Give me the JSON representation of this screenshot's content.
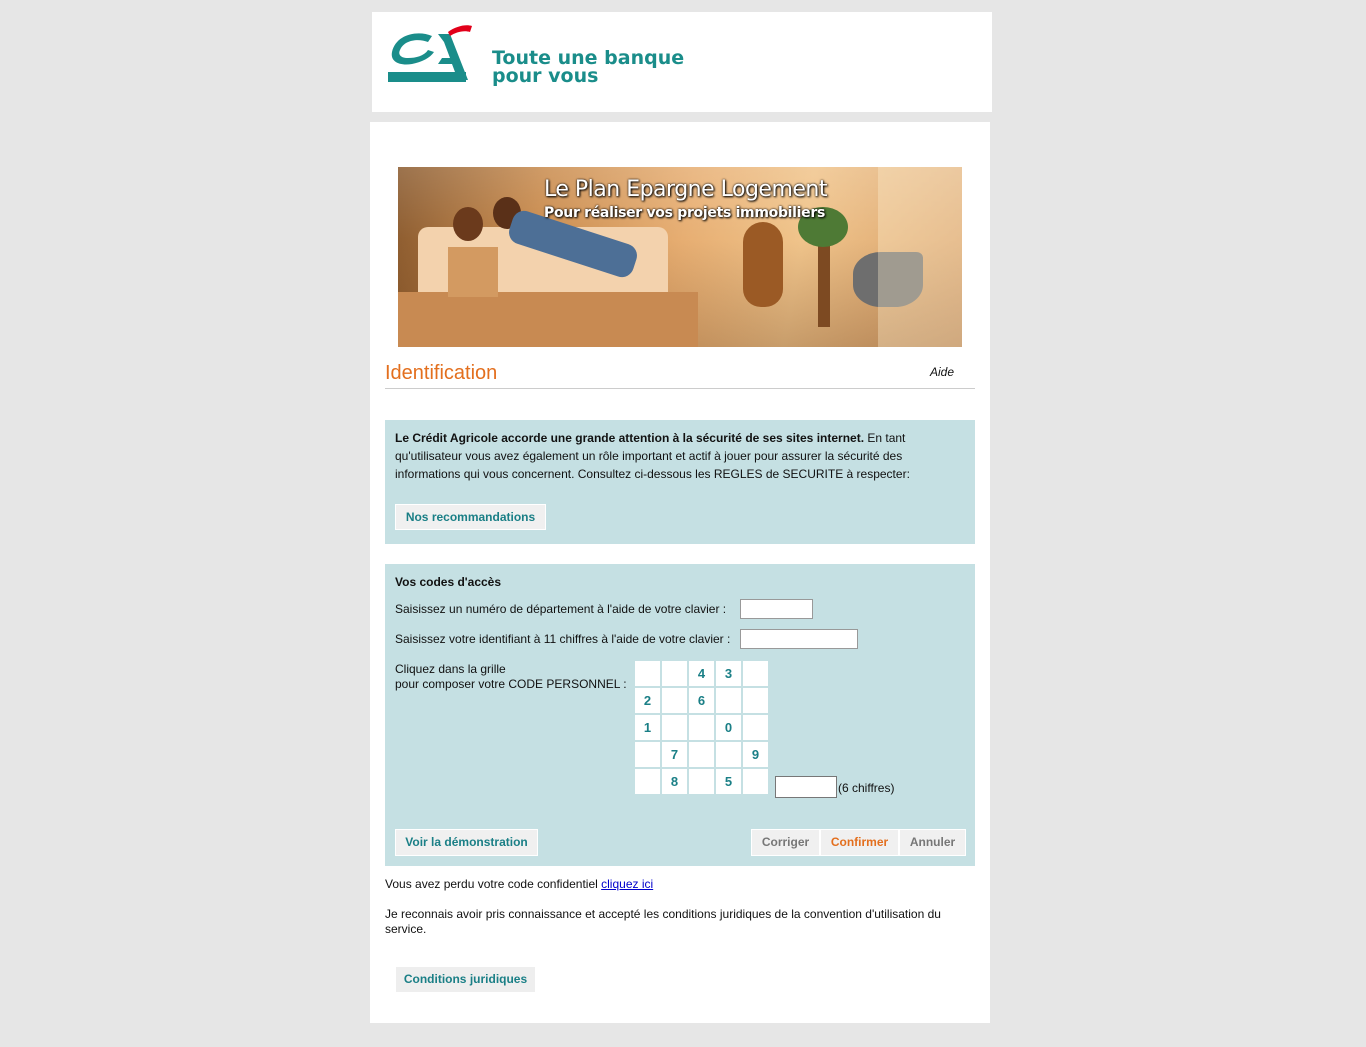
{
  "header": {
    "brand_logo": "CA",
    "tagline_line1": "Toute une banque",
    "tagline_line2": "pour vous"
  },
  "banner": {
    "title": "Le Plan Epargne Logement",
    "subtitle": "Pour réaliser vos projets immobiliers"
  },
  "identification": {
    "title": "Identification",
    "help_link": "Aide"
  },
  "security": {
    "bold_text": "Le Crédit Agricole accorde une grande attention à la sécurité de ses sites internet.",
    "body_text": " En tant qu'utilisateur vous avez également un rôle important et actif à jouer pour assurer la sécurité des informations qui vous concernent. Consultez ci-dessous les REGLES de SECURITE à respecter:",
    "button_label": "Nos recommandations"
  },
  "access": {
    "heading": "Vos codes d'accès",
    "dept_label": "Saisissez un numéro de département à l'aide de votre clavier :",
    "dept_value": "",
    "id_label": "Saisissez votre identifiant à 11 chiffres à l'aide de votre clavier :",
    "id_value": "",
    "grid_label_line1": "Cliquez dans la grille",
    "grid_label_line2": "pour composer votre CODE PERSONNEL :",
    "grid": [
      [
        "",
        "",
        "4",
        "3",
        ""
      ],
      [
        "2",
        "",
        "6",
        "",
        ""
      ],
      [
        "1",
        "",
        "",
        "0",
        ""
      ],
      [
        "",
        "7",
        "",
        "",
        "9"
      ],
      [
        "",
        "8",
        "",
        "5",
        ""
      ]
    ],
    "code_value": "",
    "code_hint": "(6 chiffres)",
    "demo_button": "Voir la démonstration",
    "correct_button": "Corriger",
    "confirm_button": "Confirmer",
    "cancel_button": "Annuler"
  },
  "footer": {
    "lost_code_text": "Vous avez perdu votre code confidentiel ",
    "lost_code_link": "cliquez ici",
    "conditions_text": "Je reconnais avoir pris connaissance et accepté les conditions juridiques de la convention d'utilisation du service.",
    "conditions_button": "Conditions juridiques"
  },
  "colors": {
    "brand_teal": "#1a8d8a",
    "accent_orange": "#e36f1e",
    "panel_bg": "#c5e0e3",
    "logo_red": "#e2001a"
  }
}
